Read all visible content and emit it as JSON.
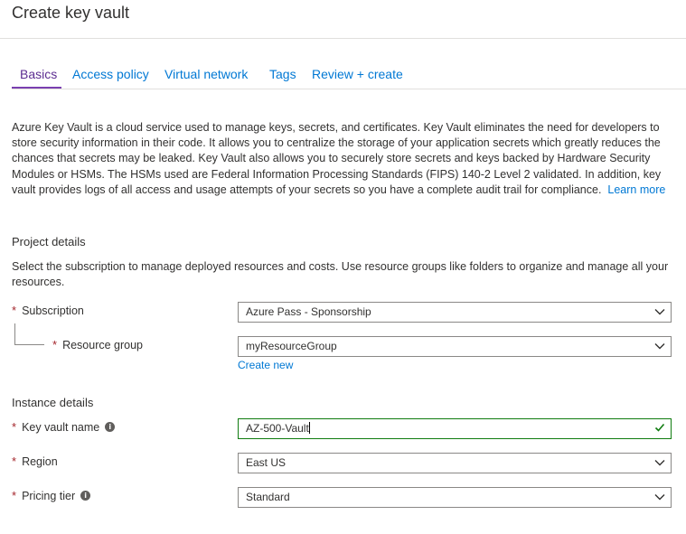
{
  "page": {
    "title": "Create key vault"
  },
  "tabs": [
    {
      "label": "Basics",
      "active": true
    },
    {
      "label": "Access policy"
    },
    {
      "label": "Virtual network"
    },
    {
      "label": "Tags"
    },
    {
      "label": "Review + create"
    }
  ],
  "intro": {
    "text": "Azure Key Vault is a cloud service used to manage keys, secrets, and certificates. Key Vault eliminates the need for developers to store security information in their code. It allows you to centralize the storage of your application secrets which greatly reduces the chances that secrets may be leaked. Key Vault also allows you to securely store secrets and keys backed by Hardware Security Modules or HSMs. The HSMs used are Federal Information Processing Standards (FIPS) 140-2 Level 2 validated. In addition, key vault provides logs of all access and usage attempts of your secrets so you have a complete audit trail for compliance.",
    "learn_more": "Learn more"
  },
  "project": {
    "heading": "Project details",
    "description": "Select the subscription to manage deployed resources and costs. Use resource groups like folders to organize and manage all your resources.",
    "subscription": {
      "label": "Subscription",
      "value": "Azure Pass - Sponsorship"
    },
    "resource_group": {
      "label": "Resource group",
      "value": "myResourceGroup",
      "create_new": "Create new"
    }
  },
  "instance": {
    "heading": "Instance details",
    "vault_name": {
      "label": "Key vault name",
      "value": "AZ-500-Vault"
    },
    "region": {
      "label": "Region",
      "value": "East US"
    },
    "pricing_tier": {
      "label": "Pricing tier",
      "value": "Standard"
    }
  },
  "common": {
    "required_mark": "*",
    "info_glyph": "i"
  },
  "colors": {
    "link": "#0078d4",
    "active_tab": "#7a3fb0",
    "required": "#a4262c",
    "valid": "#107c10"
  }
}
